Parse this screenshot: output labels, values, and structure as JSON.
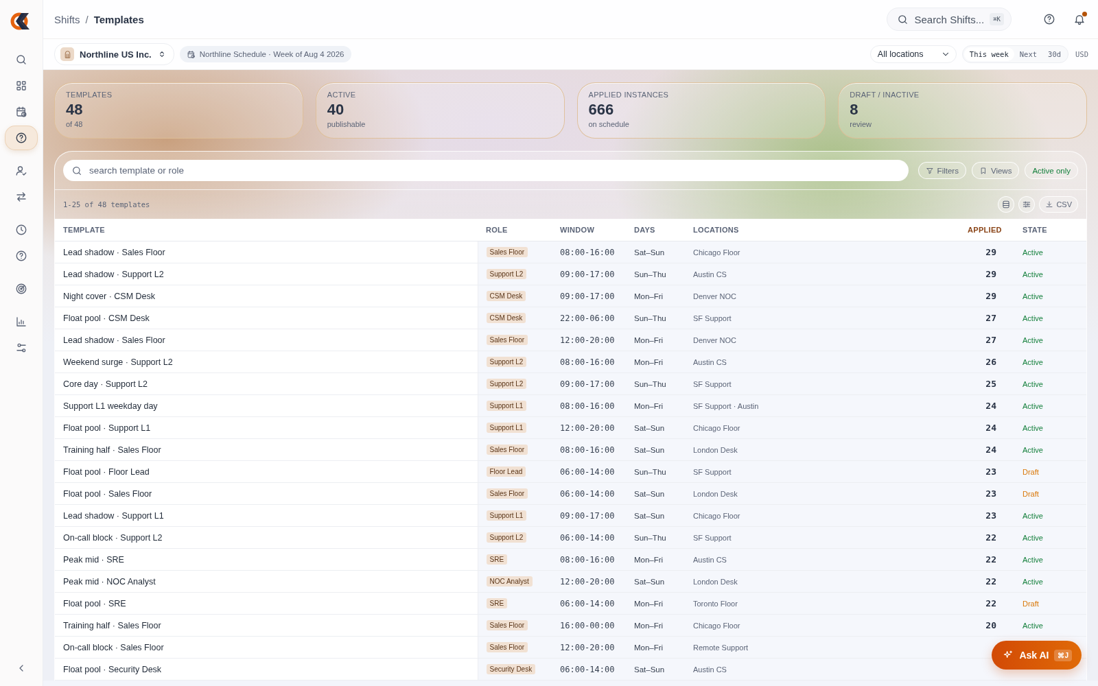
{
  "sidebar": {
    "items": [
      {
        "selected": false
      },
      {
        "selected": false
      },
      {
        "selected": false
      },
      {
        "selected": true
      },
      {
        "selected": false
      },
      {
        "selected": false
      },
      {
        "selected": false
      },
      {
        "selected": false
      },
      {
        "selected": false
      },
      {
        "selected": false
      },
      {
        "selected": false
      }
    ]
  },
  "breadcrumb": {
    "parent": "Shifts",
    "separator": "/",
    "current": "Templates"
  },
  "global_search": {
    "placeholder": "Search Shifts...",
    "shortcut": "⌘K"
  },
  "org": {
    "name": "Northline US Inc."
  },
  "schedule": "Northline Schedule · Week of Aug 4 2026",
  "location_select": {
    "value": "All locations"
  },
  "ranges": [
    {
      "label": "This week",
      "selected": true
    },
    {
      "label": "Next",
      "selected": false
    },
    {
      "label": "30d",
      "selected": false
    }
  ],
  "currency": "USD",
  "stats": [
    {
      "label": "TEMPLATES",
      "value": "48",
      "note": "of 48"
    },
    {
      "label": "ACTIVE",
      "value": "40",
      "note": "publishable"
    },
    {
      "label": "APPLIED INSTANCES",
      "value": "666",
      "note": "on schedule"
    },
    {
      "label": "DRAFT / INACTIVE",
      "value": "8",
      "note": "review"
    }
  ],
  "search": {
    "placeholder": "search template or role"
  },
  "filters": [
    {
      "label": "Filters",
      "kind": "filter"
    },
    {
      "label": "Views",
      "kind": "views"
    },
    {
      "label": "Active only",
      "kind": "toggle"
    }
  ],
  "count": "1-25 of 48 templates",
  "csv": "CSV",
  "table": {
    "columns": [
      "TEMPLATE",
      "ROLE",
      "WINDOW",
      "DAYS",
      "LOCATIONS",
      "APPLIED",
      "STATE"
    ],
    "rows": [
      {
        "template": "Lead shadow · Sales Floor",
        "role": "Sales Floor",
        "window": "08:00-16:00",
        "days": "Sat–Sun",
        "location": "Chicago Floor",
        "applied": "29",
        "state": "Active",
        "kind": "active"
      },
      {
        "template": "Lead shadow · Support L2",
        "role": "Support L2",
        "window": "09:00-17:00",
        "days": "Sun–Thu",
        "location": "Austin CS",
        "applied": "29",
        "state": "Active",
        "kind": "active"
      },
      {
        "template": "Night cover · CSM Desk",
        "role": "CSM Desk",
        "window": "09:00-17:00",
        "days": "Mon–Fri",
        "location": "Denver NOC",
        "applied": "29",
        "state": "Active",
        "kind": "active"
      },
      {
        "template": "Float pool · CSM Desk",
        "role": "CSM Desk",
        "window": "22:00-06:00",
        "days": "Sun–Thu",
        "location": "SF Support",
        "applied": "27",
        "state": "Active",
        "kind": "active"
      },
      {
        "template": "Lead shadow · Sales Floor",
        "role": "Sales Floor",
        "window": "12:00-20:00",
        "days": "Mon–Fri",
        "location": "Denver NOC",
        "applied": "27",
        "state": "Active",
        "kind": "active"
      },
      {
        "template": "Weekend surge · Support L2",
        "role": "Support L2",
        "window": "08:00-16:00",
        "days": "Mon–Fri",
        "location": "Austin CS",
        "applied": "26",
        "state": "Active",
        "kind": "active"
      },
      {
        "template": "Core day · Support L2",
        "role": "Support L2",
        "window": "09:00-17:00",
        "days": "Sun–Thu",
        "location": "SF Support",
        "applied": "25",
        "state": "Active",
        "kind": "active"
      },
      {
        "template": "Support L1 weekday day",
        "role": "Support L1",
        "window": "08:00-16:00",
        "days": "Mon–Fri",
        "location": "SF Support · Austin",
        "applied": "24",
        "state": "Active",
        "kind": "active"
      },
      {
        "template": "Float pool · Support L1",
        "role": "Support L1",
        "window": "12:00-20:00",
        "days": "Sat–Sun",
        "location": "Chicago Floor",
        "applied": "24",
        "state": "Active",
        "kind": "active"
      },
      {
        "template": "Training half · Sales Floor",
        "role": "Sales Floor",
        "window": "08:00-16:00",
        "days": "Sat–Sun",
        "location": "London Desk",
        "applied": "24",
        "state": "Active",
        "kind": "active"
      },
      {
        "template": "Float pool · Floor Lead",
        "role": "Floor Lead",
        "window": "06:00-14:00",
        "days": "Sun–Thu",
        "location": "SF Support",
        "applied": "23",
        "state": "Draft",
        "kind": "draft"
      },
      {
        "template": "Float pool · Sales Floor",
        "role": "Sales Floor",
        "window": "06:00-14:00",
        "days": "Sat–Sun",
        "location": "London Desk",
        "applied": "23",
        "state": "Draft",
        "kind": "draft"
      },
      {
        "template": "Lead shadow · Support L1",
        "role": "Support L1",
        "window": "09:00-17:00",
        "days": "Sat–Sun",
        "location": "Chicago Floor",
        "applied": "23",
        "state": "Active",
        "kind": "active"
      },
      {
        "template": "On-call block · Support L2",
        "role": "Support L2",
        "window": "06:00-14:00",
        "days": "Sun–Thu",
        "location": "SF Support",
        "applied": "22",
        "state": "Active",
        "kind": "active"
      },
      {
        "template": "Peak mid · SRE",
        "role": "SRE",
        "window": "08:00-16:00",
        "days": "Mon–Fri",
        "location": "Austin CS",
        "applied": "22",
        "state": "Active",
        "kind": "active"
      },
      {
        "template": "Peak mid · NOC Analyst",
        "role": "NOC Analyst",
        "window": "12:00-20:00",
        "days": "Sat–Sun",
        "location": "London Desk",
        "applied": "22",
        "state": "Active",
        "kind": "active"
      },
      {
        "template": "Float pool · SRE",
        "role": "SRE",
        "window": "06:00-14:00",
        "days": "Mon–Fri",
        "location": "Toronto Floor",
        "applied": "22",
        "state": "Draft",
        "kind": "draft"
      },
      {
        "template": "Training half · Sales Floor",
        "role": "Sales Floor",
        "window": "16:00-00:00",
        "days": "Mon–Fri",
        "location": "Chicago Floor",
        "applied": "20",
        "state": "Active",
        "kind": "active"
      },
      {
        "template": "On-call block · Sales Floor",
        "role": "Sales Floor",
        "window": "12:00-20:00",
        "days": "Mon–Fri",
        "location": "Remote Support"
      },
      {
        "template": "Float pool · Security Desk",
        "role": "Security Desk",
        "window": "06:00-14:00",
        "days": "Sat–Sun",
        "location": "Austin CS"
      }
    ]
  },
  "ask_ai": {
    "label": "Ask AI",
    "shortcut": "⌘J"
  }
}
